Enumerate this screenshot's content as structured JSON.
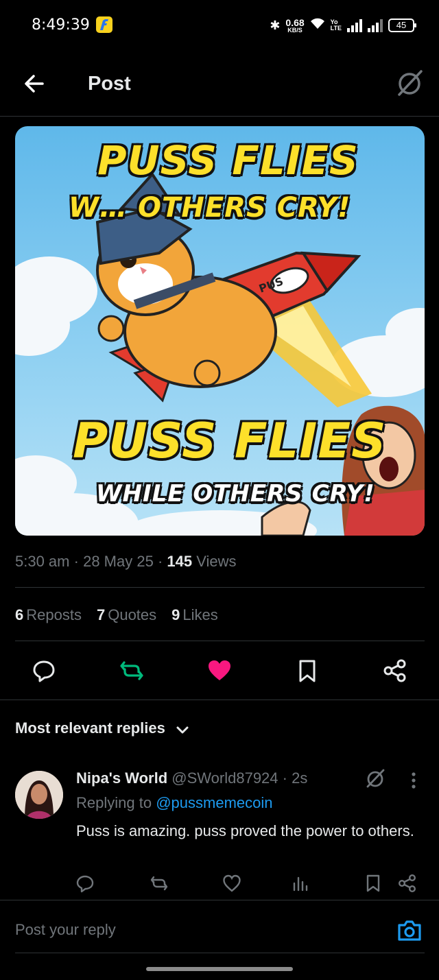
{
  "status_bar": {
    "time": "8:49:39",
    "net_speed_value": "0.68",
    "net_speed_unit": "KB/S",
    "volte_top": "Yo",
    "volte_bottom": "LTE",
    "battery": "45"
  },
  "header": {
    "title": "Post"
  },
  "post": {
    "image_text": {
      "line1": "PUSS FLIES",
      "line2": "W… OTHERS CRY!",
      "line3": "PUSS FLIES",
      "line4": "WHILE OTHERS CRY!",
      "rocket_label": "PUS"
    },
    "time": "5:30 am",
    "date": "28 May 25",
    "views_count": "145",
    "views_label": "Views",
    "separator": "·",
    "stats": {
      "reposts_count": "6",
      "reposts_label": "Reposts",
      "quotes_count": "7",
      "quotes_label": "Quotes",
      "likes_count": "9",
      "likes_label": "Likes"
    },
    "liked": true
  },
  "replies": {
    "sort_label": "Most relevant replies",
    "items": [
      {
        "name": "Nipa's World",
        "handle": "@SWorld87924",
        "time": "2s",
        "replying_prefix": "Replying to",
        "replying_handle": "@pussmemecoin",
        "text": "Puss is amazing. puss proved the power to others."
      }
    ]
  },
  "compose": {
    "placeholder": "Post your reply"
  },
  "colors": {
    "background": "#000000",
    "text_primary": "#e7e9ea",
    "text_secondary": "#71767b",
    "accent_blue": "#1d9bf0",
    "like_pink": "#f91880",
    "repost_green": "#00ba7c",
    "divider": "#2f3336"
  }
}
